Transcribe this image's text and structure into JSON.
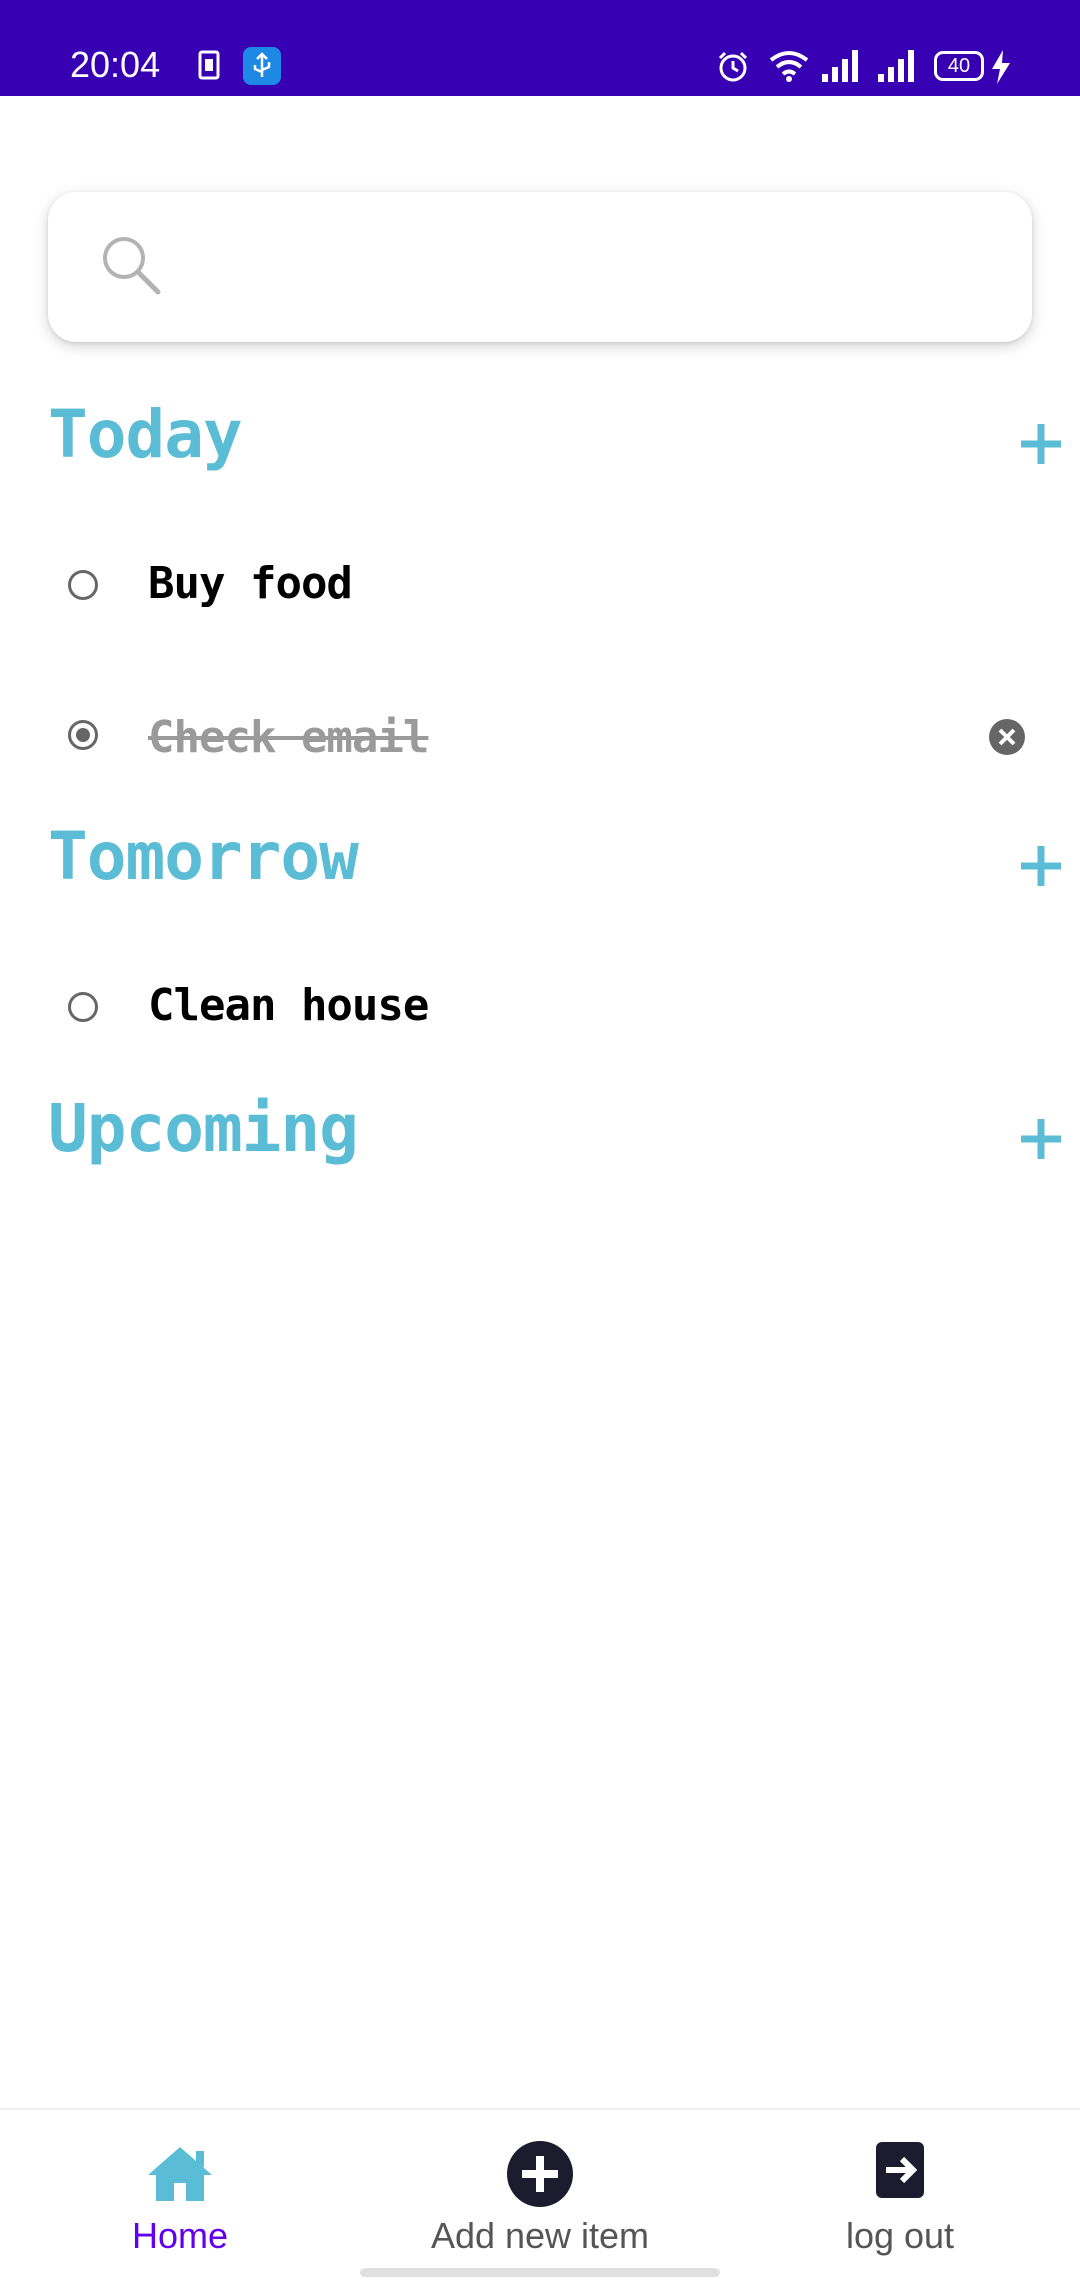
{
  "status_bar": {
    "time": "20:04",
    "battery": "40",
    "background_color": "#3700b3",
    "icons": [
      "sim-card-icon",
      "usb-icon",
      "alarm-icon",
      "wifi-icon",
      "signal-icon",
      "signal-icon",
      "battery-icon",
      "charging-icon"
    ]
  },
  "search": {
    "placeholder": "",
    "value": ""
  },
  "sections": [
    {
      "title": "Today",
      "tasks": [
        {
          "label": "Buy food",
          "done": false
        },
        {
          "label": "Check email",
          "done": true
        }
      ]
    },
    {
      "title": "Tomorrow",
      "tasks": [
        {
          "label": "Clean house",
          "done": false
        }
      ]
    },
    {
      "title": "Upcoming",
      "tasks": []
    }
  ],
  "bottom_nav": {
    "items": [
      {
        "label": "Home",
        "icon": "home-icon",
        "active": true
      },
      {
        "label": "Add new item",
        "icon": "add-circle-icon",
        "active": false
      },
      {
        "label": "log out",
        "icon": "logout-icon",
        "active": false
      }
    ]
  },
  "colors": {
    "accent": "#5bbcd6",
    "active_nav": "#6200ee",
    "status_bar": "#3700b3"
  }
}
